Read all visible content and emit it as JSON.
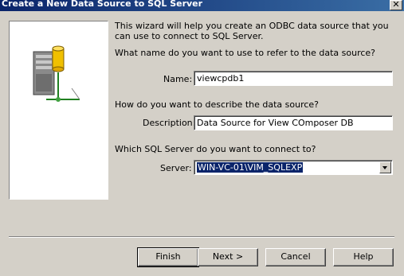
{
  "window": {
    "title": "Create a New Data Source to SQL Server",
    "close_glyph": "✕"
  },
  "intro": "This wizard will help you create an ODBC data source that you can use to connect to SQL Server.",
  "name_question": "What name do you want to use to refer to the data source?",
  "name_label": "Name:",
  "name_value": "viewcpdb1",
  "description_question": "How do you want to describe the data source?",
  "description_label": "Description:",
  "description_value": "Data Source for View COmposer DB",
  "server_question": "Which SQL Server do you want to connect to?",
  "server_label": "Server:",
  "server_value": "WIN-VC-01\\VIM_SQLEXP",
  "buttons": {
    "finish": "Finish",
    "next": "Next >",
    "cancel": "Cancel",
    "help": "Help"
  },
  "icons": {
    "wizard_art": "database-server-network-icon",
    "combo_arrow": "chevron-down-icon"
  }
}
